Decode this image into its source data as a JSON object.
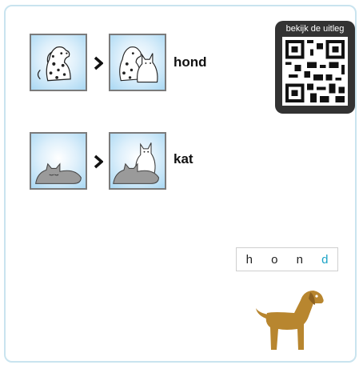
{
  "rows": [
    {
      "word": "hond",
      "from_icon": "dalmatian-dog-icon",
      "to_icon": "dog-and-cat-icon",
      "arrow_icon": "chevron-right-icon"
    },
    {
      "word": "kat",
      "from_icon": "sleeping-cat-icon",
      "to_icon": "sleeping-cat-and-white-cat-icon",
      "arrow_icon": "chevron-right-icon"
    }
  ],
  "qr": {
    "label": "bekijk de uitleg",
    "icon": "qr-code-icon"
  },
  "spelling": {
    "letters": [
      "h",
      "o",
      "n",
      "d"
    ],
    "highlight_color": "#19a3c6"
  },
  "dog_icon": "brown-dog-icon",
  "colors": {
    "frame": "#c9e4ef",
    "qr_background": "#333333",
    "dog": "#b8862f"
  }
}
